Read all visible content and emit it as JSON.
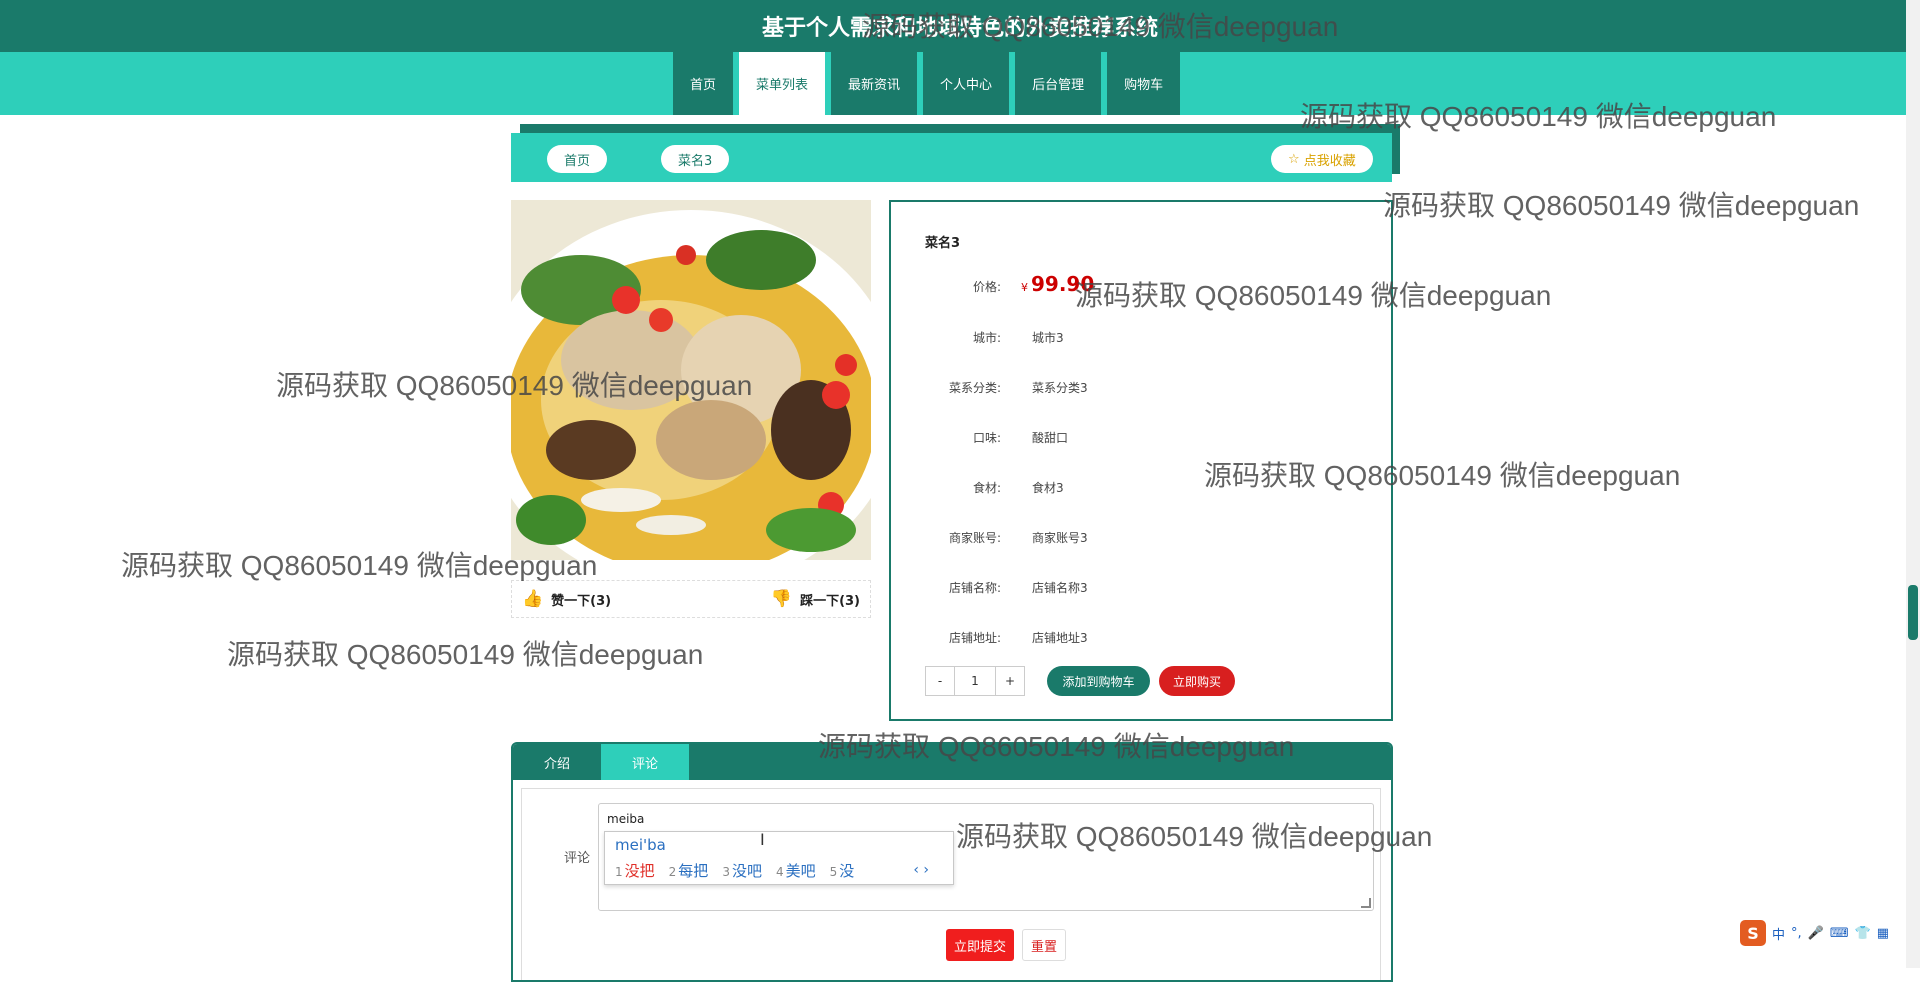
{
  "site": {
    "title": "基于个人需求和地域特色的外卖推荐系统"
  },
  "nav": {
    "items": [
      "首页",
      "菜单列表",
      "最新资讯",
      "个人中心",
      "后台管理",
      "购物车"
    ],
    "active_index": 1
  },
  "breadcrumb": {
    "home": "首页",
    "current": "菜名3",
    "favorite": "点我收藏"
  },
  "product": {
    "name": "菜名3",
    "price_label": "价格:",
    "currency": "¥",
    "price": "99.90",
    "fields": [
      {
        "label": "城市:",
        "value": "城市3"
      },
      {
        "label": "菜系分类:",
        "value": "菜系分类3"
      },
      {
        "label": "口味:",
        "value": "酸甜口"
      },
      {
        "label": "食材:",
        "value": "食材3"
      },
      {
        "label": "商家账号:",
        "value": "商家账号3"
      },
      {
        "label": "店铺名称:",
        "value": "店铺名称3"
      },
      {
        "label": "店铺地址:",
        "value": "店铺地址3"
      }
    ],
    "likes_label": "赞一下(3)",
    "dislikes_label": "踩一下(3)",
    "quantity": "1",
    "minus": "-",
    "plus": "+",
    "add_to_cart": "添加到购物车",
    "buy_now": "立即购买"
  },
  "tabs": {
    "items": [
      "介绍",
      "评论"
    ],
    "active_index": 1
  },
  "comment": {
    "label": "评论",
    "input_value": "meiba",
    "submit": "立即提交",
    "reset": "重置"
  },
  "ime_popup": {
    "pinyin": "mei'ba",
    "candidates": [
      {
        "n": "1",
        "text": "没把"
      },
      {
        "n": "2",
        "text": "每把"
      },
      {
        "n": "3",
        "text": "没吧"
      },
      {
        "n": "4",
        "text": "美吧"
      },
      {
        "n": "5",
        "text": "没"
      }
    ],
    "nav": "‹ ›"
  },
  "ime_status": {
    "logo": "S",
    "mode": "中",
    "punct": "°,"
  },
  "watermark": "源码获取 QQ86050149 微信deepguan"
}
